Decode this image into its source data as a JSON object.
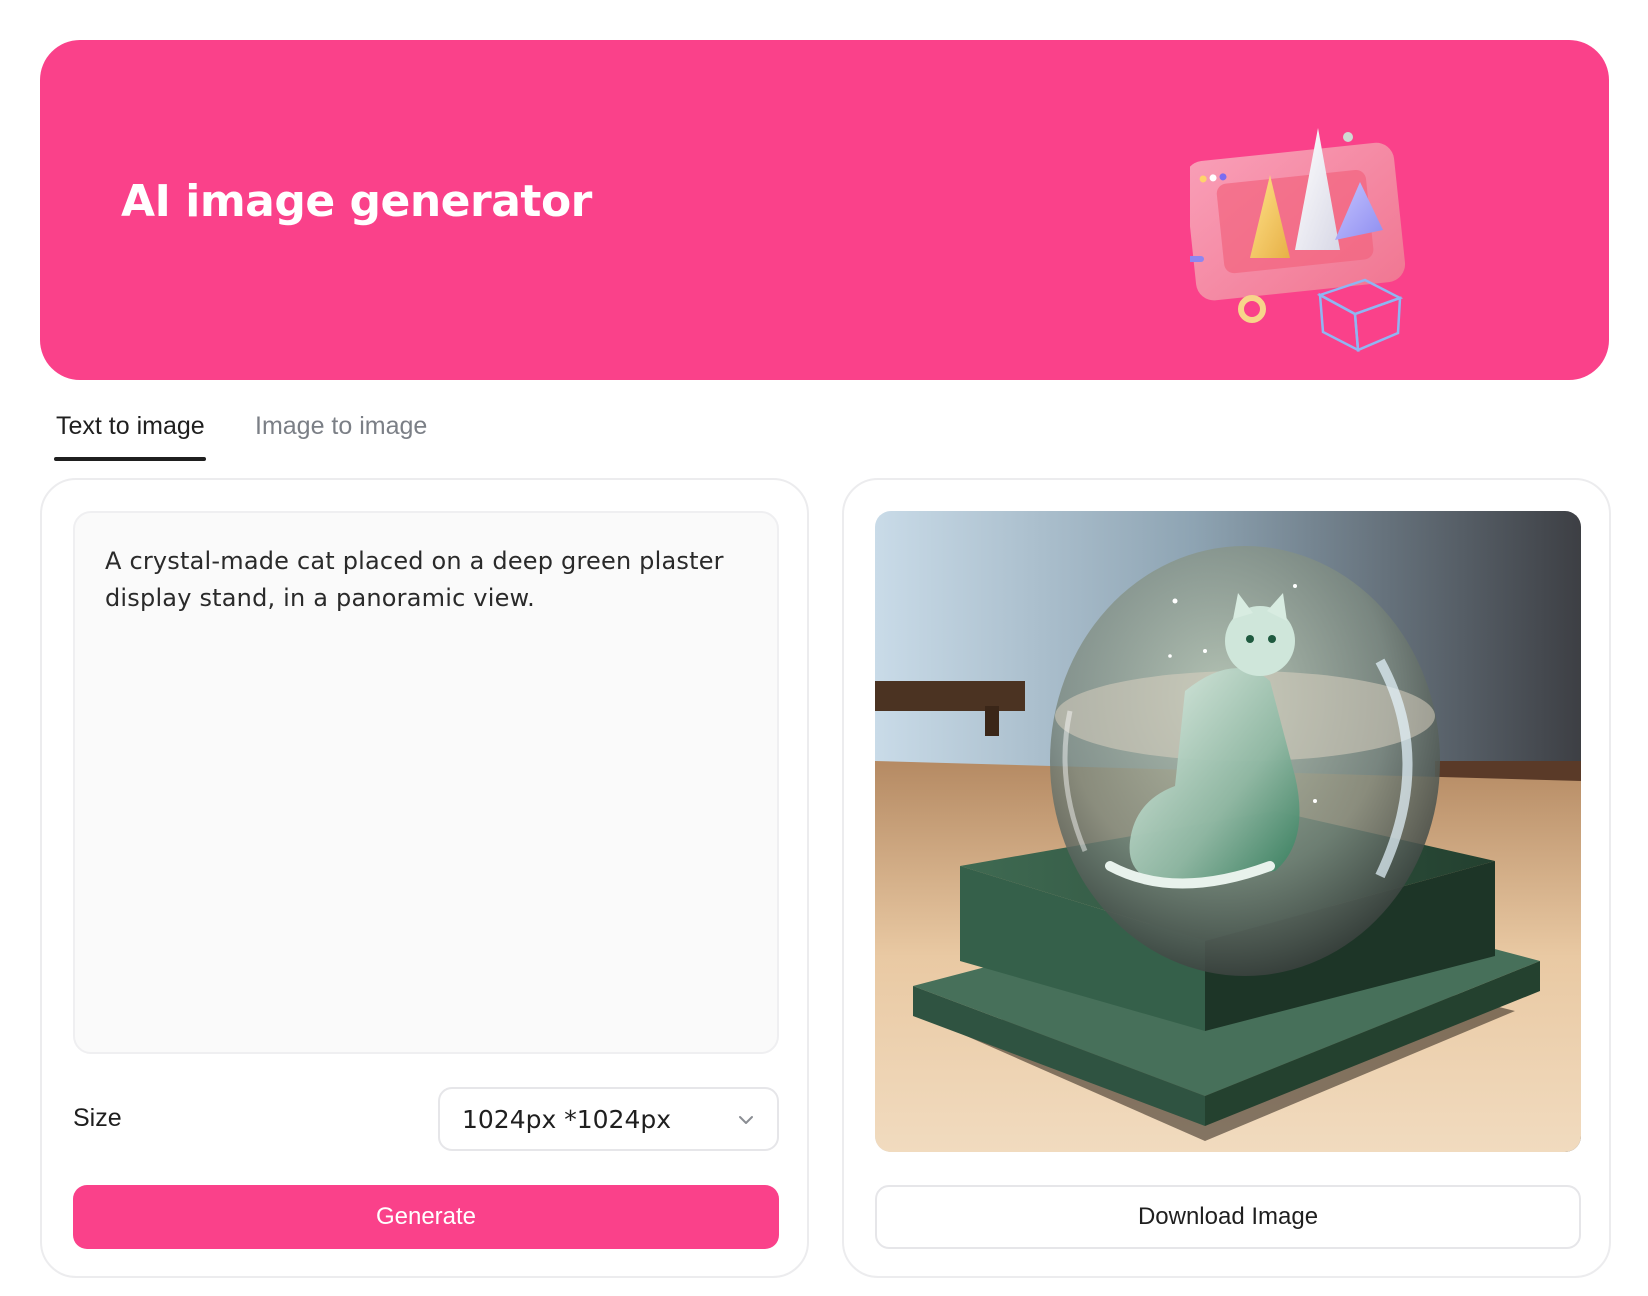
{
  "header": {
    "title": "AI image generator",
    "illustration": "abstract-3d-chart-illustration",
    "background_color": "#fa418a"
  },
  "tabs": [
    {
      "label": "Text to image",
      "active": true
    },
    {
      "label": "Image to image",
      "active": false
    }
  ],
  "prompt": {
    "value": "A crystal-made cat placed on a deep green plaster display stand, in a panoramic view."
  },
  "size": {
    "label": "Size",
    "selected": "1024px *1024px",
    "icon": "chevron-down-icon"
  },
  "generate": {
    "label": "Generate",
    "color": "#fa418a"
  },
  "result": {
    "image_description": "crystal-cat-in-glass-dome-on-green-stand",
    "download_label": "Download Image"
  }
}
